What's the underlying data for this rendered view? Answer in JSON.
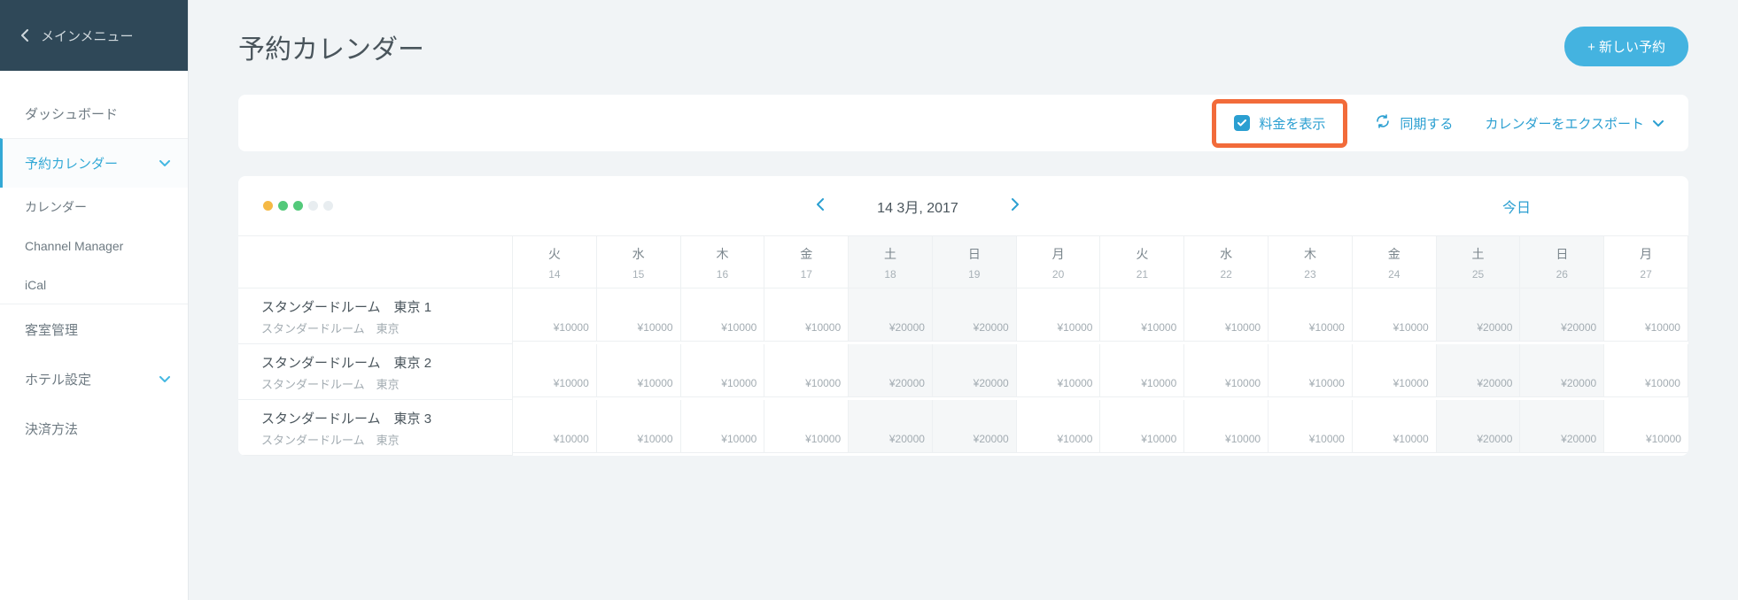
{
  "sidebar": {
    "back_label": "メインメニュー",
    "items": [
      {
        "label": "ダッシュボード",
        "active": false
      },
      {
        "label": "予約カレンダー",
        "active": true,
        "expandable": true
      }
    ],
    "sub_items": [
      {
        "label": "カレンダー"
      },
      {
        "label": "Channel Manager"
      },
      {
        "label": "iCal"
      }
    ],
    "items2": [
      {
        "label": "客室管理"
      },
      {
        "label": "ホテル設定",
        "expandable": true
      },
      {
        "label": "決済方法"
      }
    ]
  },
  "page": {
    "title": "予約カレンダー",
    "new_button": "+ 新しい予約"
  },
  "toolbar": {
    "show_rates": "料金を表示",
    "sync": "同期する",
    "export": "カレンダーをエクスポート"
  },
  "calendar": {
    "date_label": "14 3月, 2017",
    "today": "今日",
    "dot_colors": [
      "#f5b945",
      "#53c97a",
      "#53c97a",
      "#e8edf0",
      "#e8edf0"
    ],
    "days": [
      {
        "dw": "火",
        "dn": "14",
        "weekend": false
      },
      {
        "dw": "水",
        "dn": "15",
        "weekend": false
      },
      {
        "dw": "木",
        "dn": "16",
        "weekend": false
      },
      {
        "dw": "金",
        "dn": "17",
        "weekend": false
      },
      {
        "dw": "土",
        "dn": "18",
        "weekend": true
      },
      {
        "dw": "日",
        "dn": "19",
        "weekend": true
      },
      {
        "dw": "月",
        "dn": "20",
        "weekend": false
      },
      {
        "dw": "火",
        "dn": "21",
        "weekend": false
      },
      {
        "dw": "水",
        "dn": "22",
        "weekend": false
      },
      {
        "dw": "木",
        "dn": "23",
        "weekend": false
      },
      {
        "dw": "金",
        "dn": "24",
        "weekend": false
      },
      {
        "dw": "土",
        "dn": "25",
        "weekend": true
      },
      {
        "dw": "日",
        "dn": "26",
        "weekend": true
      },
      {
        "dw": "月",
        "dn": "27",
        "weekend": false
      }
    ],
    "rooms": [
      {
        "name": "スタンダードルーム　東京 1",
        "type": "スタンダードルーム　東京",
        "prices": [
          "¥10000",
          "¥10000",
          "¥10000",
          "¥10000",
          "¥20000",
          "¥20000",
          "¥10000",
          "¥10000",
          "¥10000",
          "¥10000",
          "¥10000",
          "¥20000",
          "¥20000",
          "¥10000"
        ]
      },
      {
        "name": "スタンダードルーム　東京 2",
        "type": "スタンダードルーム　東京",
        "prices": [
          "¥10000",
          "¥10000",
          "¥10000",
          "¥10000",
          "¥20000",
          "¥20000",
          "¥10000",
          "¥10000",
          "¥10000",
          "¥10000",
          "¥10000",
          "¥20000",
          "¥20000",
          "¥10000"
        ]
      },
      {
        "name": "スタンダードルーム　東京 3",
        "type": "スタンダードルーム　東京",
        "prices": [
          "¥10000",
          "¥10000",
          "¥10000",
          "¥10000",
          "¥20000",
          "¥20000",
          "¥10000",
          "¥10000",
          "¥10000",
          "¥10000",
          "¥10000",
          "¥20000",
          "¥20000",
          "¥10000"
        ]
      }
    ]
  }
}
